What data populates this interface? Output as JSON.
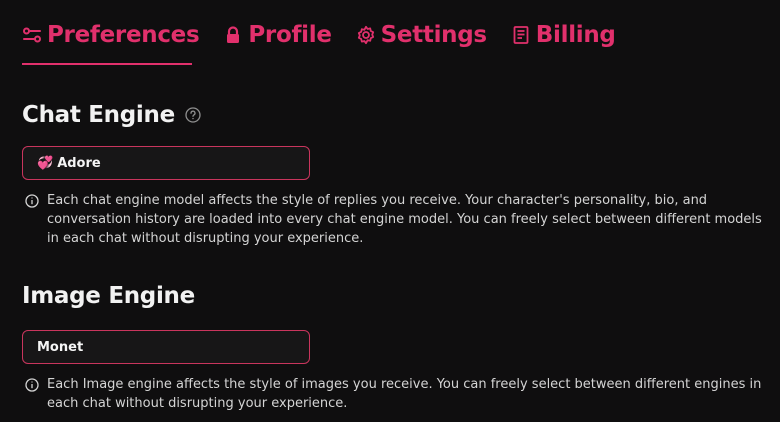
{
  "tabs": [
    {
      "label": "Preferences",
      "icon": "sliders-icon",
      "active": true
    },
    {
      "label": "Profile",
      "icon": "lock-icon",
      "active": false
    },
    {
      "label": "Settings",
      "icon": "gear-icon",
      "active": false
    },
    {
      "label": "Billing",
      "icon": "document-icon",
      "active": false
    }
  ],
  "chat_engine": {
    "title": "Chat Engine",
    "selected": "Adore",
    "selected_emoji": "💞",
    "info": "Each chat engine model affects the style of replies you receive. Your character's personality, bio, and conversation history are loaded into every chat engine model. You can freely select between different models in each chat without disrupting your experience."
  },
  "image_engine": {
    "title": "Image Engine",
    "selected": "Monet",
    "info": "Each Image engine affects the style of images you receive. You can freely select between different engines in each chat without disrupting your experience."
  },
  "colors": {
    "accent": "#e1306c",
    "background": "#0f0e0f",
    "border": "#c9355d"
  }
}
